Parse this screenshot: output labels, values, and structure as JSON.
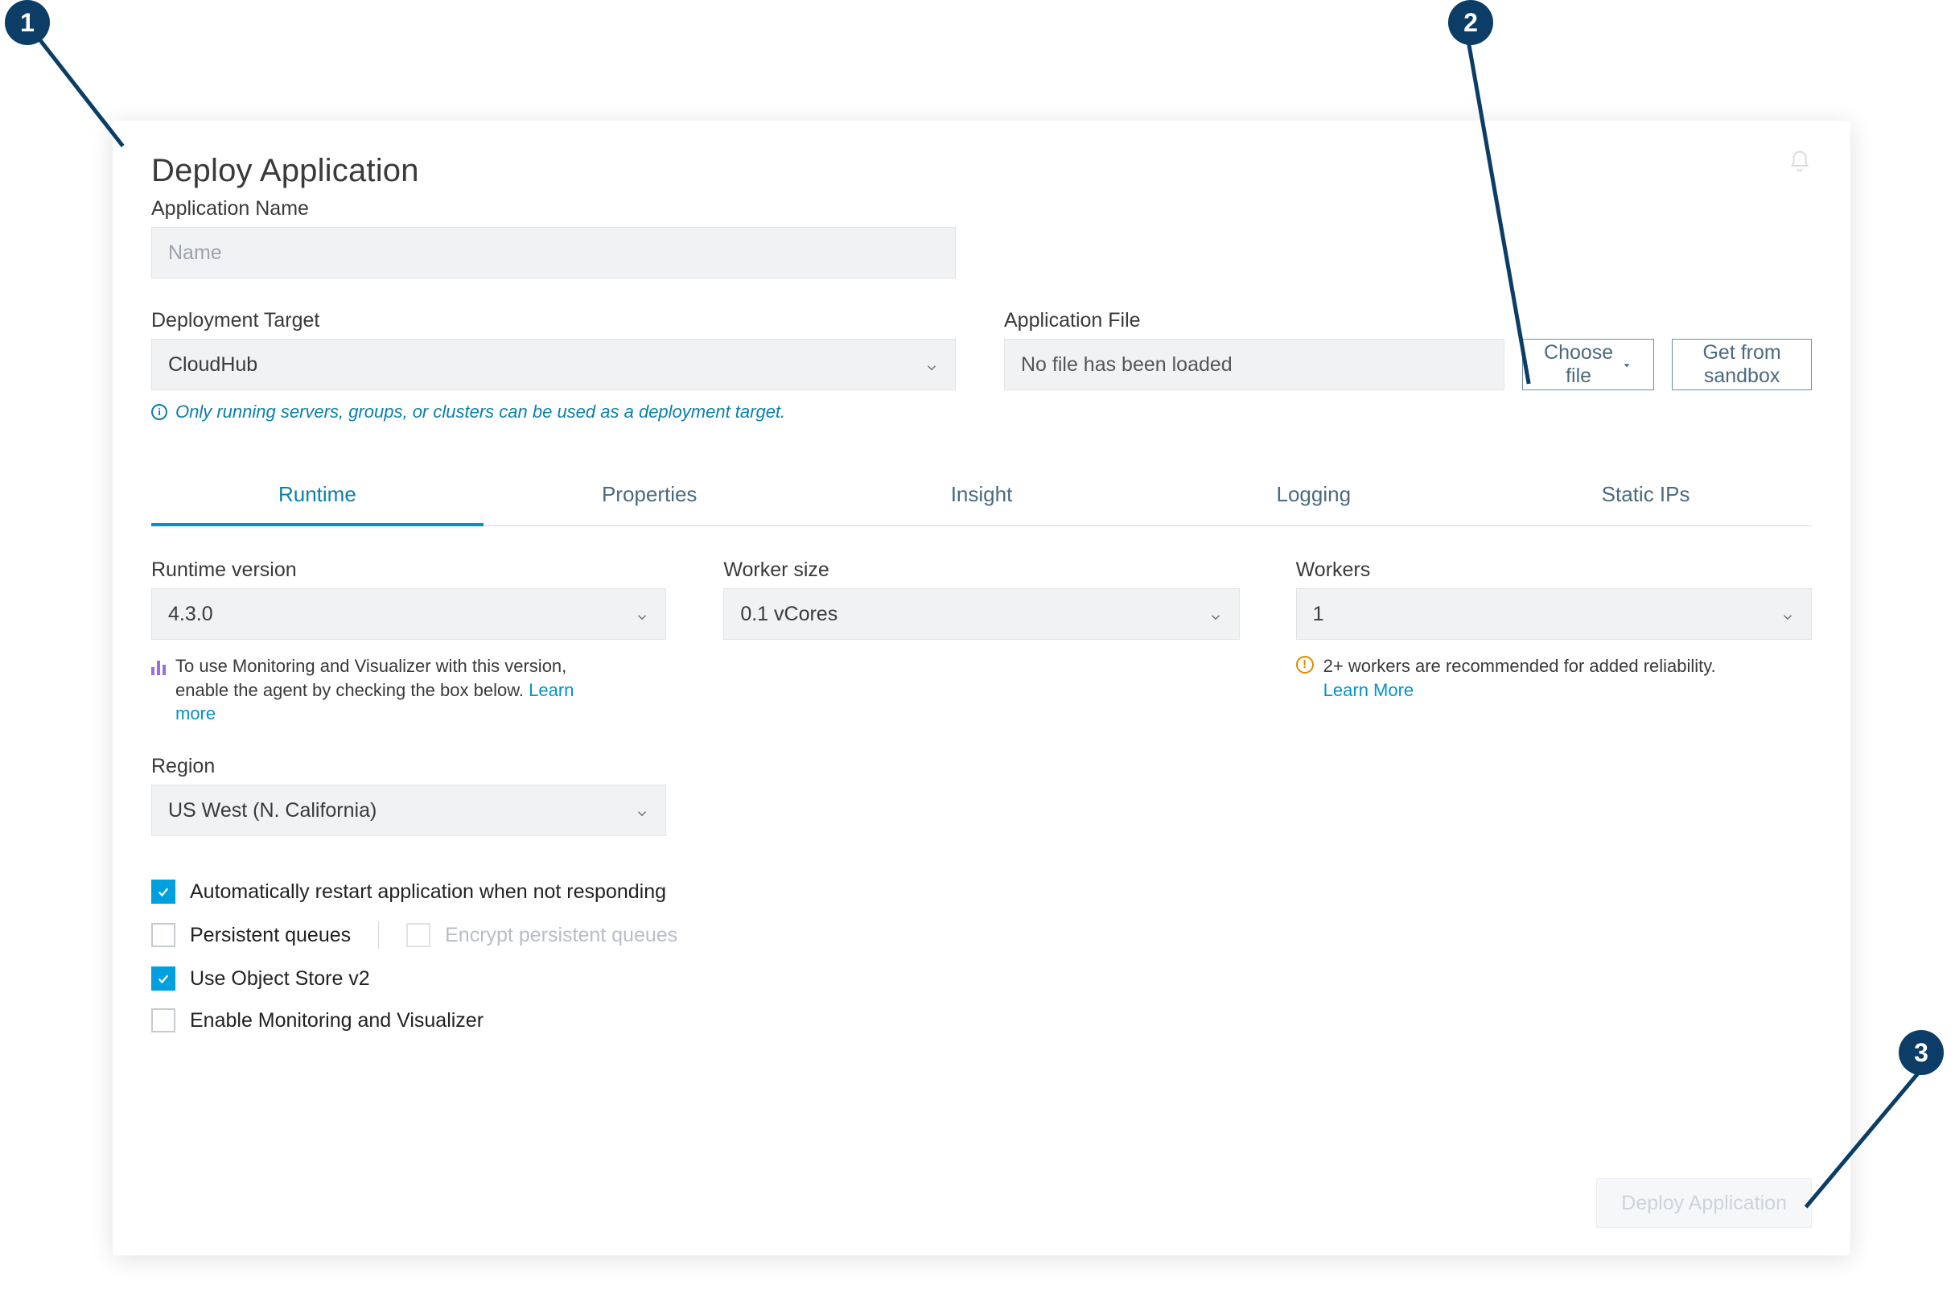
{
  "title": "Deploy Application",
  "appName": {
    "label": "Application Name",
    "placeholder": "Name",
    "value": ""
  },
  "deploymentTarget": {
    "label": "Deployment Target",
    "value": "CloudHub",
    "helper": "Only running servers, groups, or clusters can be used as a deployment target."
  },
  "applicationFile": {
    "label": "Application File",
    "status": "No file has been loaded",
    "chooseBtn": "Choose file",
    "sandboxBtn": "Get from sandbox"
  },
  "tabs": [
    "Runtime",
    "Properties",
    "Insight",
    "Logging",
    "Static IPs"
  ],
  "activeTab": 0,
  "runtime": {
    "versionLabel": "Runtime version",
    "versionValue": "4.3.0",
    "versionNote": "To use Monitoring and Visualizer with this version, enable the agent by checking the box below.",
    "versionNoteLink": "Learn more",
    "workerSizeLabel": "Worker size",
    "workerSizeValue": "0.1 vCores",
    "workersLabel": "Workers",
    "workersValue": "1",
    "workersNote": "2+ workers are recommended for added reliability.",
    "workersNoteLink": "Learn More",
    "regionLabel": "Region",
    "regionValue": "US West (N. California)"
  },
  "checks": {
    "autoRestart": {
      "label": "Automatically restart application when not responding",
      "checked": true
    },
    "persistentQueues": {
      "label": "Persistent queues",
      "checked": false
    },
    "encryptQueues": {
      "label": "Encrypt persistent queues",
      "checked": false,
      "disabled": true
    },
    "objectStore": {
      "label": "Use Object Store v2",
      "checked": true
    },
    "monitoring": {
      "label": "Enable Monitoring and Visualizer",
      "checked": false
    }
  },
  "deployBtn": "Deploy Application",
  "annotations": {
    "1": "1",
    "2": "2",
    "3": "3"
  }
}
